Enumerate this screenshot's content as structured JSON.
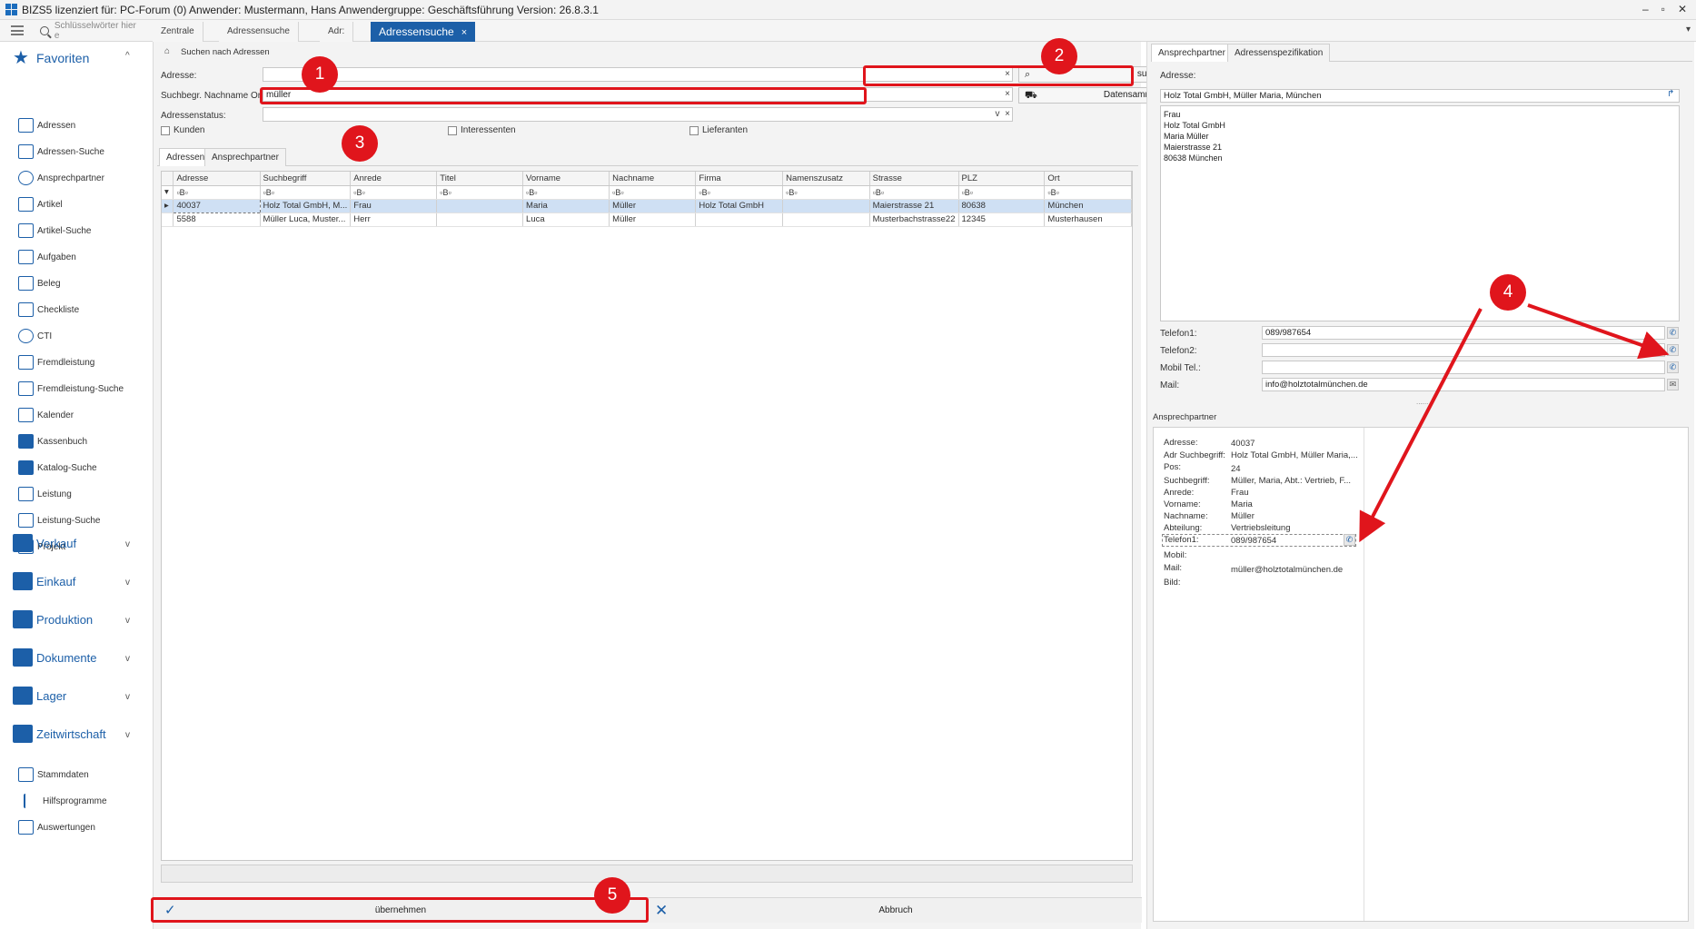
{
  "window": {
    "title": "BIZS5  lizenziert für: PC-Forum (0)  Anwender: Mustermann, Hans  Anwendergruppe: Geschäftsführung  Version: 26.8.3.1",
    "controls": [
      "–",
      "▫",
      "✕"
    ]
  },
  "topbar": {
    "keyword_placeholder": "Schlüsselwörter hier e",
    "tabs": [
      "Zentrale",
      "Adressensuche",
      "Adr:",
      "Adressensuche"
    ],
    "active_tab_close": "×",
    "dropdown": "▾"
  },
  "sidebar": {
    "favorites_label": "Favoriten",
    "favorites_chevron": "^",
    "items": [
      "Adressen",
      "Adressen-Suche",
      "Ansprechpartner",
      "Artikel",
      "Artikel-Suche",
      "Aufgaben",
      "Beleg",
      "Checkliste",
      "CTI",
      "Fremdleistung",
      "Fremdleistung-Suche",
      "Kalender",
      "Kassenbuch",
      "Katalog-Suche",
      "Leistung",
      "Leistung-Suche",
      "Projekt"
    ],
    "sections": [
      "Verkauf",
      "Einkauf",
      "Produktion",
      "Dokumente",
      "Lager",
      "Zeitwirtschaft"
    ],
    "section_chevron": "v",
    "bottom_items": [
      "Stammdaten",
      "Hilfsprogramme",
      "Auswertungen"
    ]
  },
  "search": {
    "group_label": "Suchen nach Adressen",
    "address_label": "Adresse:",
    "address_value": "",
    "name_label": "Suchbegr. Nachname Ort:",
    "name_value": "müller",
    "status_label": "Adressenstatus:",
    "status_value": "",
    "clear_x": "×",
    "dropdown_v": "v",
    "search_button": "suchen",
    "collector_button": "Datensammler einfügen",
    "checkboxes": [
      "Kunden",
      "Interessenten",
      "Lieferanten"
    ]
  },
  "grid": {
    "tabs": [
      "Adressen",
      "Ansprechpartner"
    ],
    "columns": [
      "Adresse",
      "Suchbegriff",
      "Anrede",
      "Titel",
      "Vorname",
      "Nachname",
      "Firma",
      "Namenszusatz",
      "Strasse",
      "PLZ",
      "Ort"
    ],
    "filter_marker": "▾",
    "filter_cell": "▫B▫",
    "row_indicator": "▸",
    "rows": [
      [
        "40037",
        "Holz Total GmbH, M...",
        "Frau",
        "",
        "Maria",
        "Müller",
        "Holz Total GmbH",
        "",
        "Maierstrasse 21",
        "80638",
        "München"
      ],
      [
        "5588",
        "Müller Luca, Muster...",
        "Herr",
        "",
        "Luca",
        "Müller",
        "",
        "",
        "Musterbachstrasse22",
        "12345",
        "Musterhausen"
      ]
    ]
  },
  "footer": {
    "apply_label": "übernehmen",
    "cancel_label": "Abbruch",
    "check_icon": "✓",
    "cross_icon": "✕"
  },
  "right": {
    "tabs": [
      "Ansprechpartner",
      "Adressenspezifikation"
    ],
    "address_label": "Adresse:",
    "address_line": "Holz Total GmbH, Müller Maria, München",
    "address_block": [
      "Frau",
      "Holz Total GmbH",
      "Maria Müller",
      "Maierstrasse 21",
      "80638 München"
    ],
    "phone_rows": [
      {
        "label": "Telefon1:",
        "value": "089/987654"
      },
      {
        "label": "Telefon2:",
        "value": ""
      },
      {
        "label": "Mobil Tel.:",
        "value": ""
      },
      {
        "label": "Mail:",
        "value": "info@holztotalmünchen.de"
      }
    ],
    "splitter": "......",
    "phone_glyph": "✆",
    "mail_glyph": "✉",
    "contact_section": "Ansprechpartner",
    "contact_details": [
      {
        "label": "Adresse:",
        "value": "40037"
      },
      {
        "label": "Adr Suchbegriff:",
        "value": "Holz Total GmbH, Müller Maria,..."
      },
      {
        "label": "Pos:",
        "value": "24"
      },
      {
        "label": "Suchbegriff:",
        "value": "Müller, Maria, Abt.: Vertrieb, F..."
      },
      {
        "label": "Anrede:",
        "value": "Frau"
      },
      {
        "label": "Vorname:",
        "value": "Maria"
      },
      {
        "label": "Nachname:",
        "value": "Müller"
      },
      {
        "label": "Abteilung:",
        "value": "Vertriebsleitung"
      },
      {
        "label": "Telefon1:",
        "value": "089/987654"
      },
      {
        "label": "Mobil:",
        "value": ""
      },
      {
        "label": "Mail:",
        "value": "müller@holztotalmünchen.de"
      },
      {
        "label": "Bild:",
        "value": ""
      }
    ]
  },
  "annotations": {
    "badges": [
      "1",
      "2",
      "3",
      "4",
      "5"
    ],
    "accent": "#e0151c"
  }
}
